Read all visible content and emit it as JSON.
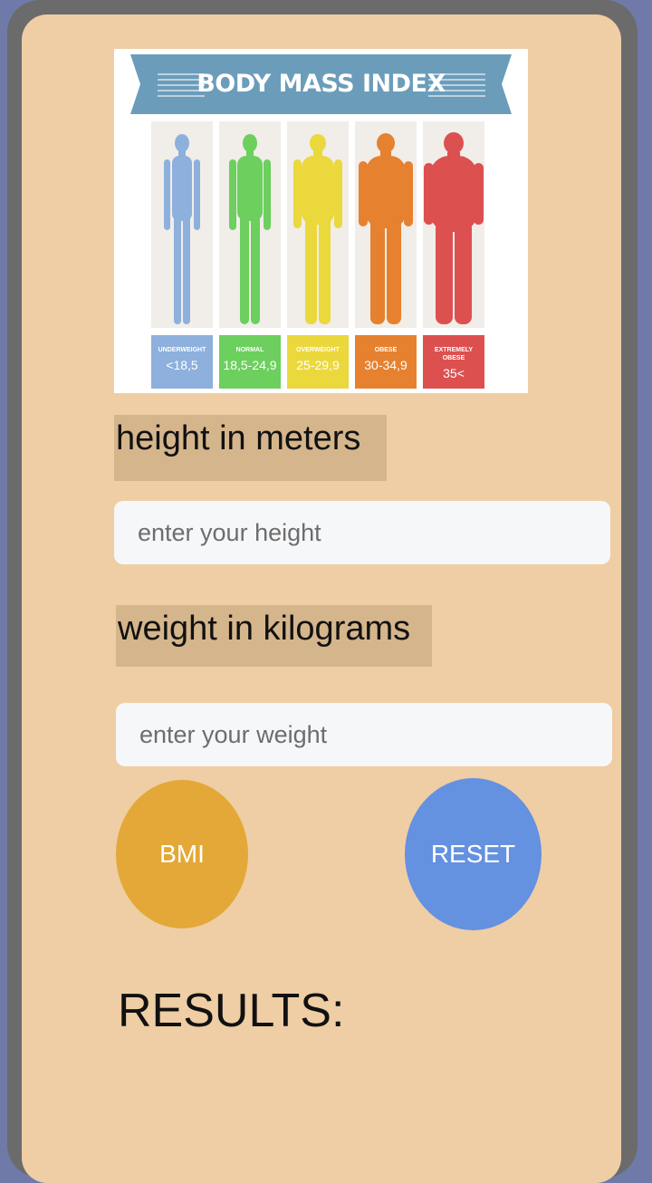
{
  "image": {
    "title": "BODY MASS INDEX",
    "categories": [
      {
        "label": "UNDERWEIGHT",
        "range": "<18,5",
        "color": "#8db0dc"
      },
      {
        "label": "NORMAL",
        "range": "18,5-24,9",
        "color": "#6ccf5e"
      },
      {
        "label": "OVERWEIGHT",
        "range": "25-29,9",
        "color": "#ebd83c"
      },
      {
        "label": "OBESE",
        "range": "30-34,9",
        "color": "#e5812f"
      },
      {
        "label": "EXTREMELY OBESE",
        "range": "35<",
        "color": "#dd5050"
      }
    ]
  },
  "height": {
    "label": "height in meters",
    "placeholder": "enter your height",
    "value": ""
  },
  "weight": {
    "label": "weight in kilograms",
    "placeholder": "enter your weight",
    "value": ""
  },
  "buttons": {
    "bmi_label": "BMI",
    "bmi_color": "#e3a837",
    "reset_label": "RESET",
    "reset_color": "#6491e0"
  },
  "results": {
    "label": "RESULTS:"
  }
}
